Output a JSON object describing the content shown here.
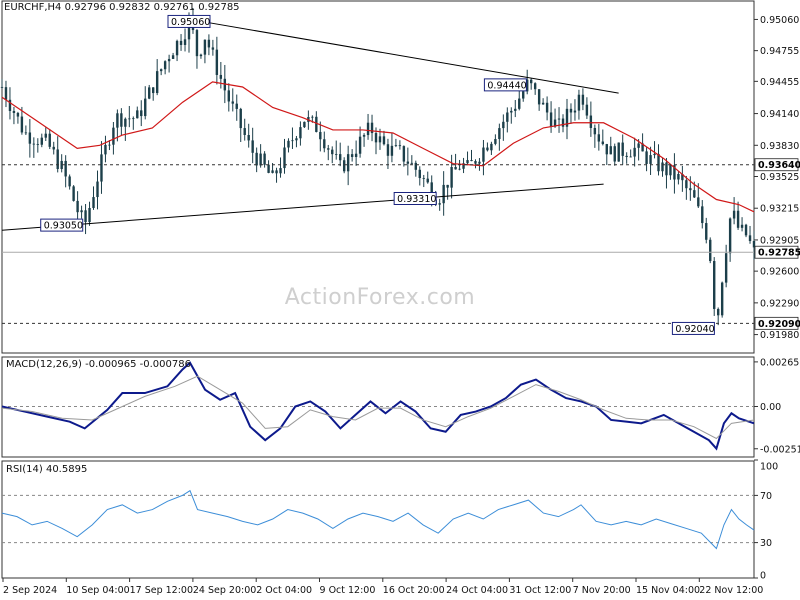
{
  "header": {
    "symbol": "EURCHF,H4",
    "ohlc": "0.92796 0.92832 0.92761 0.92785",
    "macd": "MACD(12,26,9) -0.000965 -0.000786",
    "rsi": "RSI(14) 40.5895"
  },
  "watermark": "ActionForex.com",
  "colors": {
    "candle": "#1c3f4a",
    "ma": "#d01818",
    "macd_line": "#0d1a8c",
    "signal_line": "#9a9a9a",
    "rsi_line": "#3d8ed8",
    "trendline": "#000000",
    "grid": "#444444",
    "label_border": "#1a237e"
  },
  "chart_data": [
    {
      "type": "candlestick",
      "panel": "price",
      "ylim": [
        0.918,
        0.9525
      ],
      "y_ticks": [
        "0.95060",
        "0.94755",
        "0.94455",
        "0.94140",
        "0.93830",
        "0.93525",
        "0.93215",
        "0.92905",
        "0.92600",
        "0.92290",
        "0.91980"
      ],
      "x_ticks": [
        "2 Sep 2024",
        "10 Sep 04:00",
        "17 Sep 12:00",
        "24 Sep 20:00",
        "2 Oct 04:00",
        "9 Oct 12:00",
        "16 Oct 20:00",
        "24 Oct 04:00",
        "31 Oct 12:00",
        "7 Nov 20:00",
        "15 Nov 04:00",
        "22 Nov 12:00"
      ],
      "close_path": [
        [
          0,
          0.944
        ],
        [
          3,
          0.9395
        ],
        [
          6,
          0.9385
        ],
        [
          8,
          0.936
        ],
        [
          10,
          0.932
        ],
        [
          11,
          0.9305
        ],
        [
          13,
          0.936
        ],
        [
          15,
          0.941
        ],
        [
          18,
          0.941
        ],
        [
          20,
          0.944
        ],
        [
          22,
          0.947
        ],
        [
          24,
          0.949
        ],
        [
          25,
          0.9506
        ],
        [
          26,
          0.947
        ],
        [
          27,
          0.949
        ],
        [
          28,
          0.947
        ],
        [
          30,
          0.943
        ],
        [
          33,
          0.938
        ],
        [
          36,
          0.935
        ],
        [
          38,
          0.938
        ],
        [
          40,
          0.941
        ],
        [
          42,
          0.94
        ],
        [
          45,
          0.936
        ],
        [
          47,
          0.938
        ],
        [
          49,
          0.94
        ],
        [
          51,
          0.938
        ],
        [
          53,
          0.9375
        ],
        [
          55,
          0.936
        ],
        [
          57,
          0.934
        ],
        [
          58,
          0.9331
        ],
        [
          59,
          0.9345
        ],
        [
          61,
          0.9365
        ],
        [
          62,
          0.936
        ],
        [
          64,
          0.938
        ],
        [
          66,
          0.94
        ],
        [
          68,
          0.942
        ],
        [
          70,
          0.9444
        ],
        [
          72,
          0.942
        ],
        [
          74,
          0.94
        ],
        [
          76,
          0.942
        ],
        [
          77,
          0.9435
        ],
        [
          79,
          0.9395
        ],
        [
          81,
          0.9375
        ],
        [
          84,
          0.938
        ],
        [
          86,
          0.937
        ],
        [
          88,
          0.936
        ],
        [
          90,
          0.935
        ],
        [
          92,
          0.933
        ],
        [
          94,
          0.929
        ],
        [
          95,
          0.9204
        ],
        [
          96,
          0.927
        ],
        [
          97,
          0.932
        ],
        [
          98,
          0.93
        ],
        [
          99,
          0.9295
        ],
        [
          100,
          0.9278
        ]
      ],
      "ma_path": [
        [
          0,
          0.943
        ],
        [
          5,
          0.9405
        ],
        [
          10,
          0.938
        ],
        [
          13,
          0.9383
        ],
        [
          16,
          0.9393
        ],
        [
          20,
          0.94
        ],
        [
          24,
          0.9425
        ],
        [
          28,
          0.9445
        ],
        [
          32,
          0.944
        ],
        [
          36,
          0.942
        ],
        [
          40,
          0.941
        ],
        [
          44,
          0.9398
        ],
        [
          48,
          0.9398
        ],
        [
          52,
          0.9395
        ],
        [
          56,
          0.938
        ],
        [
          60,
          0.9365
        ],
        [
          64,
          0.9363
        ],
        [
          68,
          0.9385
        ],
        [
          72,
          0.94
        ],
        [
          76,
          0.9405
        ],
        [
          80,
          0.9405
        ],
        [
          84,
          0.939
        ],
        [
          88,
          0.937
        ],
        [
          92,
          0.9345
        ],
        [
          95,
          0.933
        ],
        [
          98,
          0.9325
        ],
        [
          100,
          0.9318
        ]
      ],
      "trendlines": [
        {
          "from": [
            25,
            0.9506
          ],
          "to": [
            82,
            0.9434
          ]
        },
        {
          "from": [
            0,
            0.93
          ],
          "to": [
            80,
            0.9345
          ]
        }
      ],
      "hlines": [
        {
          "value": 0.9364,
          "label": "0.93640"
        },
        {
          "value": 0.9209,
          "label": "0.92090"
        }
      ],
      "current": {
        "value": 0.92785,
        "label": "0.92785"
      },
      "annotations": [
        {
          "text": "0.95060",
          "x": 25,
          "y": 0.9506
        },
        {
          "text": "0.94440",
          "x": 70,
          "y": 0.9444
        },
        {
          "text": "0.93310",
          "x": 58,
          "y": 0.9331
        },
        {
          "text": "0.93050",
          "x": 11,
          "y": 0.9305
        },
        {
          "text": "0.92040",
          "x": 95,
          "y": 0.9204
        }
      ]
    },
    {
      "type": "line",
      "panel": "macd",
      "ylim": [
        -0.003,
        0.003
      ],
      "y_ticks": [
        "0.00265",
        "0.00",
        "-0.002511"
      ],
      "series": [
        {
          "role": "macd",
          "points": [
            [
              0,
              0.0
            ],
            [
              3,
              -0.0003
            ],
            [
              6,
              -0.0006
            ],
            [
              9,
              -0.0009
            ],
            [
              11,
              -0.0013
            ],
            [
              14,
              -0.0002
            ],
            [
              16,
              0.0008
            ],
            [
              19,
              0.0008
            ],
            [
              22,
              0.0012
            ],
            [
              24,
              0.0022
            ],
            [
              25,
              0.0026
            ],
            [
              27,
              0.001
            ],
            [
              29,
              0.0004
            ],
            [
              31,
              0.0008
            ],
            [
              33,
              -0.0012
            ],
            [
              35,
              -0.002
            ],
            [
              37,
              -0.0013
            ],
            [
              39,
              0.0
            ],
            [
              41,
              0.0003
            ],
            [
              43,
              -0.0003
            ],
            [
              45,
              -0.0013
            ],
            [
              47,
              -0.0005
            ],
            [
              49,
              0.0003
            ],
            [
              51,
              -0.0004
            ],
            [
              53,
              0.0003
            ],
            [
              55,
              -0.0003
            ],
            [
              57,
              -0.0013
            ],
            [
              59,
              -0.0015
            ],
            [
              61,
              -0.0005
            ],
            [
              63,
              -0.0003
            ],
            [
              65,
              0.0
            ],
            [
              67,
              0.0005
            ],
            [
              69,
              0.0013
            ],
            [
              71,
              0.0016
            ],
            [
              73,
              0.001
            ],
            [
              75,
              0.0005
            ],
            [
              77,
              0.0003
            ],
            [
              79,
              0.0
            ],
            [
              81,
              -0.0008
            ],
            [
              83,
              -0.0009
            ],
            [
              85,
              -0.001
            ],
            [
              88,
              -0.0005
            ],
            [
              90,
              -0.001
            ],
            [
              92,
              -0.0015
            ],
            [
              94,
              -0.002
            ],
            [
              95,
              -0.0025
            ],
            [
              96,
              -0.001
            ],
            [
              97,
              -0.0004
            ],
            [
              98,
              -0.0007
            ],
            [
              100,
              -0.001
            ]
          ]
        },
        {
          "role": "signal",
          "points": [
            [
              0,
              -0.0001
            ],
            [
              4,
              -0.0003
            ],
            [
              8,
              -0.0007
            ],
            [
              12,
              -0.0008
            ],
            [
              15,
              -0.0002
            ],
            [
              19,
              0.0006
            ],
            [
              23,
              0.0012
            ],
            [
              26,
              0.0018
            ],
            [
              29,
              0.001
            ],
            [
              32,
              0.0002
            ],
            [
              35,
              -0.0013
            ],
            [
              38,
              -0.0012
            ],
            [
              41,
              -0.0002
            ],
            [
              44,
              -0.0006
            ],
            [
              47,
              -0.0008
            ],
            [
              50,
              -0.0001
            ],
            [
              53,
              -0.0001
            ],
            [
              56,
              -0.0008
            ],
            [
              59,
              -0.0012
            ],
            [
              62,
              -0.0006
            ],
            [
              65,
              -0.0001
            ],
            [
              68,
              0.0006
            ],
            [
              71,
              0.0013
            ],
            [
              74,
              0.0009
            ],
            [
              77,
              0.0004
            ],
            [
              80,
              -0.0002
            ],
            [
              83,
              -0.0007
            ],
            [
              86,
              -0.0008
            ],
            [
              89,
              -0.0008
            ],
            [
              92,
              -0.0012
            ],
            [
              95,
              -0.0019
            ],
            [
              97,
              -0.001
            ],
            [
              100,
              -0.0008
            ]
          ]
        }
      ]
    },
    {
      "type": "line",
      "panel": "rsi",
      "ylim": [
        0,
        100
      ],
      "y_ticks": [
        "100",
        "70",
        "30",
        "0"
      ],
      "levels": [
        70,
        30
      ],
      "series": [
        {
          "role": "rsi",
          "points": [
            [
              0,
              55
            ],
            [
              2,
              52
            ],
            [
              4,
              45
            ],
            [
              6,
              48
            ],
            [
              8,
              42
            ],
            [
              10,
              35
            ],
            [
              12,
              45
            ],
            [
              14,
              58
            ],
            [
              16,
              62
            ],
            [
              18,
              55
            ],
            [
              20,
              58
            ],
            [
              22,
              65
            ],
            [
              24,
              70
            ],
            [
              25,
              74
            ],
            [
              26,
              58
            ],
            [
              28,
              55
            ],
            [
              30,
              52
            ],
            [
              32,
              48
            ],
            [
              34,
              45
            ],
            [
              36,
              50
            ],
            [
              38,
              58
            ],
            [
              40,
              55
            ],
            [
              42,
              50
            ],
            [
              44,
              42
            ],
            [
              46,
              50
            ],
            [
              48,
              55
            ],
            [
              50,
              52
            ],
            [
              52,
              48
            ],
            [
              54,
              55
            ],
            [
              56,
              45
            ],
            [
              58,
              38
            ],
            [
              60,
              50
            ],
            [
              62,
              55
            ],
            [
              64,
              50
            ],
            [
              66,
              58
            ],
            [
              68,
              62
            ],
            [
              70,
              66
            ],
            [
              72,
              55
            ],
            [
              74,
              52
            ],
            [
              76,
              58
            ],
            [
              77,
              62
            ],
            [
              79,
              48
            ],
            [
              81,
              45
            ],
            [
              83,
              48
            ],
            [
              85,
              45
            ],
            [
              87,
              50
            ],
            [
              89,
              46
            ],
            [
              91,
              42
            ],
            [
              93,
              38
            ],
            [
              95,
              25
            ],
            [
              96,
              45
            ],
            [
              97,
              58
            ],
            [
              98,
              50
            ],
            [
              99,
              45
            ],
            [
              100,
              40.6
            ]
          ]
        }
      ]
    }
  ]
}
